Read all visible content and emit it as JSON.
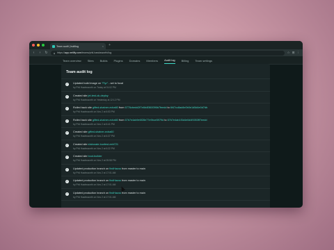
{
  "browser": {
    "tab_title": "Team audit | builtlog",
    "url_prefix": "https://",
    "url_host": "app.netlify.com",
    "url_path": "/teams/phil-hawksworth/log",
    "colors": {
      "close": "#ff5f56",
      "min": "#ffbd2e",
      "max": "#27c93f"
    }
  },
  "appnav": {
    "items": [
      {
        "label": "Team overview",
        "active": false
      },
      {
        "label": "Sites",
        "active": false
      },
      {
        "label": "Builds",
        "active": false
      },
      {
        "label": "Plugins",
        "active": false
      },
      {
        "label": "Domains",
        "active": false
      },
      {
        "label": "Members",
        "active": false
      },
      {
        "label": "Audit log",
        "active": true
      },
      {
        "label": "Billing",
        "active": false
      },
      {
        "label": "Team settings",
        "active": false
      }
    ]
  },
  "page": {
    "title": "Team audit log"
  },
  "log": [
    {
      "pre": "Updated build image on ",
      "h1": "\"Flyr\"",
      "mid": " - set to focal",
      "h2": "",
      "post": "",
      "h3": "",
      "tail": "",
      "meta": "by Phil Hawksworth on Today at 01:02 PM"
    },
    {
      "pre": "Created site ",
      "h1": "jet-test-ok-deploy",
      "mid": "",
      "h2": "",
      "post": "",
      "h3": "",
      "tail": "",
      "meta": "by Phil Hawksworth on Yesterday at 12:12 PM"
    },
    {
      "pre": "Rolled back site ",
      "h1": "gifted-shatner-ecba60",
      "mid": " from ",
      "h2": "6776cbedd2f7e6b4f360096b7feedd",
      "post": " to ",
      "h3": "6f47cc8ad4e0b0e1d5d4e0d7db",
      "tail": "",
      "meta": "by Phil Hawksworth on Nov 2 at 6:53 PM"
    },
    {
      "pre": "Rolled back site ",
      "h1": "gifted-shatner-ecba60",
      "mid": " from ",
      "h2": "67b7e4ab9e6f28e77e9bce5979d",
      "post": " to ",
      "h3": "67b7e4ab1f3d4e0d4f0053ff7eedd",
      "tail": "",
      "meta": "by Phil Hawksworth on Nov 2 at 6:41 PM"
    },
    {
      "pre": "Created site ",
      "h1": "gifted-shatner-ecba60",
      "mid": "",
      "h2": "",
      "post": "",
      "h3": "",
      "tail": "",
      "meta": "by Phil Hawksworth on Nov 2 at 6:37 PM"
    },
    {
      "pre": "Created site ",
      "h1": "elaborate-bunfest-eeb721",
      "mid": "",
      "h2": "",
      "post": "",
      "h3": "",
      "tail": "",
      "meta": "by Phil Hawksworth on Nov 2 at 6:22 PM"
    },
    {
      "pre": "Created site ",
      "h1": "boot-builder",
      "mid": "",
      "h2": "",
      "post": "",
      "h3": "",
      "tail": "",
      "meta": "by Phil Hawksworth on Nov 2 at 05:58 PM"
    },
    {
      "pre": "Updated production branch on ",
      "h1": "findHauss",
      "mid": " from master to main",
      "h2": "",
      "post": "",
      "h3": "",
      "tail": "",
      "meta": "by Phil Hawksworth on Nov 2 at 17:01 AM"
    },
    {
      "pre": "Updated production branch on ",
      "h1": "findHauss",
      "mid": " from master to main",
      "h2": "",
      "post": "",
      "h3": "",
      "tail": "",
      "meta": "by Phil Hawksworth on Nov 2 at 17:01 AM"
    },
    {
      "pre": "Updated production branch on ",
      "h1": "findHauss",
      "mid": " from master to main",
      "h2": "",
      "post": "",
      "h3": "",
      "tail": "",
      "meta": "by Phil Hawksworth on Nov 2 at 17:01 AM"
    }
  ]
}
